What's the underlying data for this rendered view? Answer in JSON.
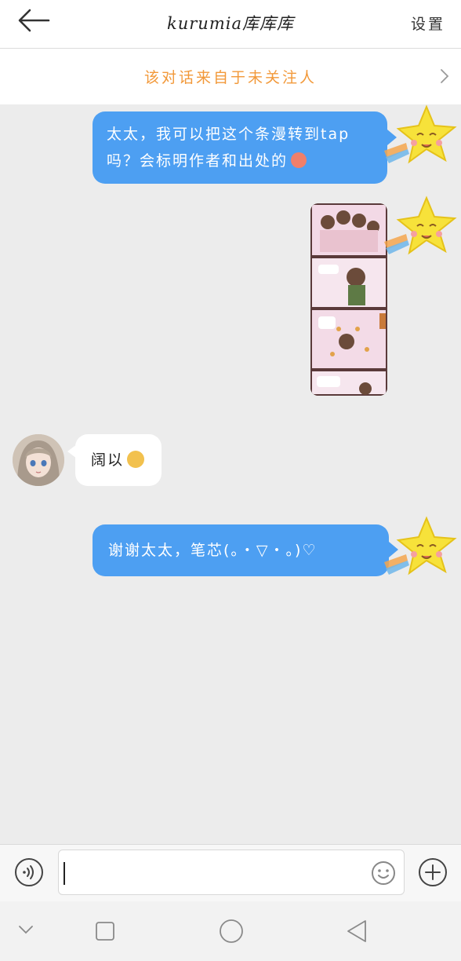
{
  "header": {
    "title": "kurumia库库库",
    "settings_label": "设置"
  },
  "source_bar": {
    "text": "该对话来自于未关注人"
  },
  "messages": [
    {
      "direction": "outgoing",
      "text": "太太，我可以把这个条漫转到tap吗？会标明作者和出处的"
    },
    {
      "direction": "outgoing",
      "type": "image"
    },
    {
      "direction": "incoming",
      "text": "阔以"
    },
    {
      "direction": "outgoing",
      "text": "谢谢太太，笔芯(。・▽・。)♡"
    }
  ],
  "input": {
    "placeholder": "",
    "value": ""
  },
  "colors": {
    "outgoing_bubble": "#4d9ff2",
    "incoming_bubble": "#ffffff",
    "source_text": "#f2993a",
    "background": "#ececec"
  },
  "icons": {
    "back": "back-arrow-icon",
    "source_arrow": "chevron-right-icon",
    "voice": "voice-icon",
    "emoji": "smiley-icon",
    "plus": "plus-icon",
    "nav_down": "chevron-down-icon",
    "nav_recent": "square-icon",
    "nav_home": "circle-icon",
    "nav_back": "triangle-back-icon",
    "sticker": "star-icon"
  }
}
